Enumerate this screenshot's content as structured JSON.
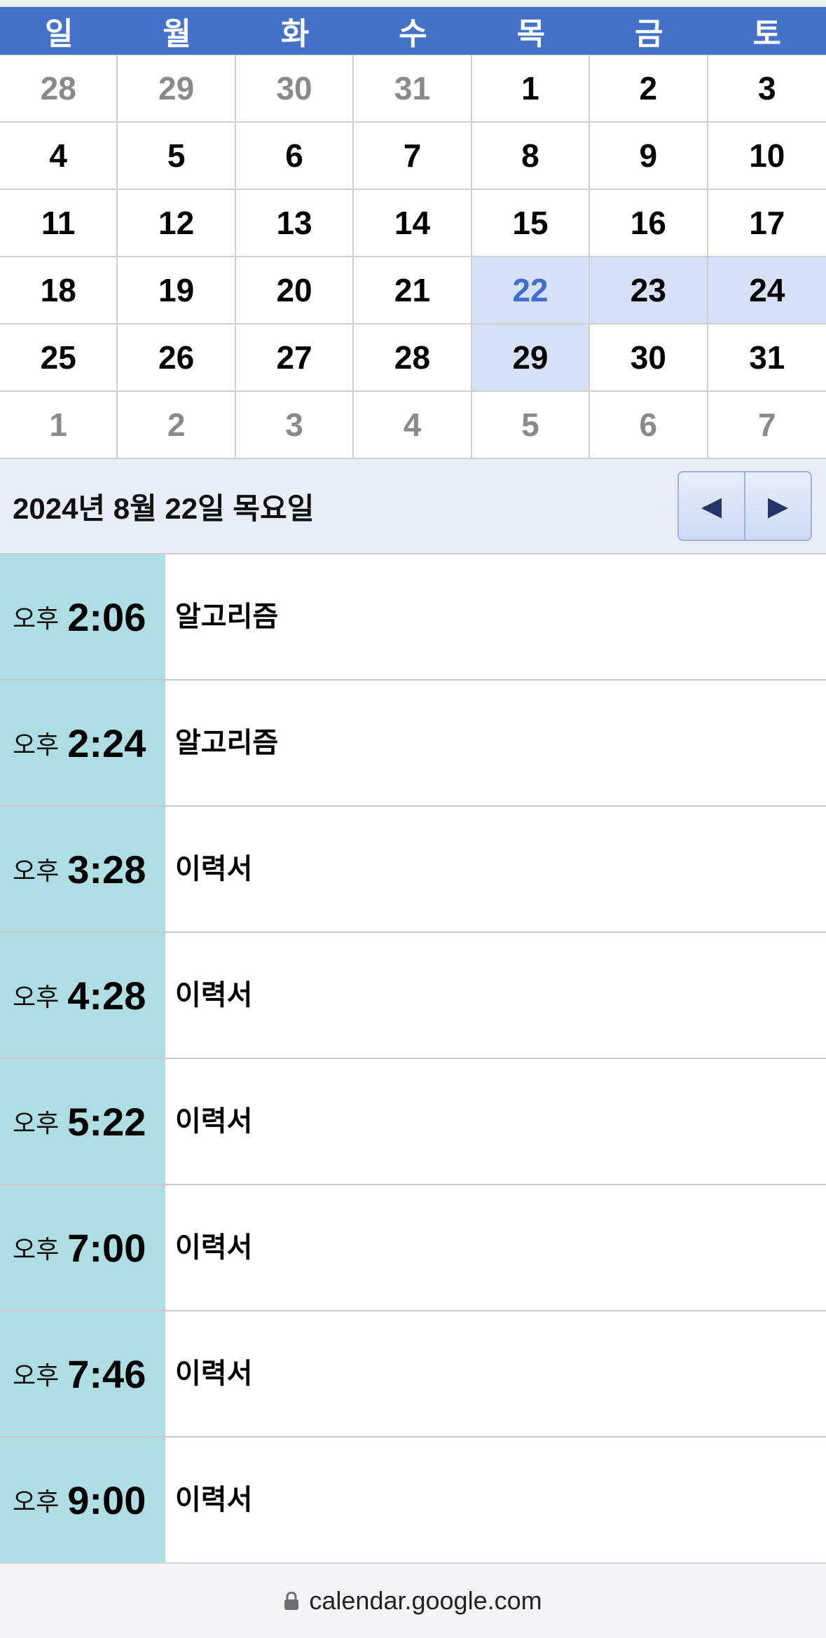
{
  "calendar": {
    "weekdays": [
      "일",
      "월",
      "화",
      "수",
      "목",
      "금",
      "토"
    ],
    "weeks": [
      [
        "28",
        "29",
        "30",
        "31",
        "1",
        "2",
        "3"
      ],
      [
        "4",
        "5",
        "6",
        "7",
        "8",
        "9",
        "10"
      ],
      [
        "11",
        "12",
        "13",
        "14",
        "15",
        "16",
        "17"
      ],
      [
        "18",
        "19",
        "20",
        "21",
        "22",
        "23",
        "24"
      ],
      [
        "25",
        "26",
        "27",
        "28",
        "29",
        "30",
        "31"
      ],
      [
        "1",
        "2",
        "3",
        "4",
        "5",
        "6",
        "7"
      ]
    ]
  },
  "date_header": {
    "title": "2024년 8월 22일 목요일",
    "prev_icon": "◀",
    "next_icon": "▶"
  },
  "events": [
    {
      "ampm": "오후",
      "time": "2:06",
      "title": "알고리즘"
    },
    {
      "ampm": "오후",
      "time": "2:24",
      "title": "알고리즘"
    },
    {
      "ampm": "오후",
      "time": "3:28",
      "title": "이력서"
    },
    {
      "ampm": "오후",
      "time": "4:28",
      "title": "이력서"
    },
    {
      "ampm": "오후",
      "time": "5:22",
      "title": "이력서"
    },
    {
      "ampm": "오후",
      "time": "7:00",
      "title": "이력서"
    },
    {
      "ampm": "오후",
      "time": "7:46",
      "title": "이력서"
    },
    {
      "ampm": "오후",
      "time": "9:00",
      "title": "이력서"
    }
  ],
  "browser": {
    "url": "calendar.google.com"
  },
  "colors": {
    "header_blue": "#4472c9",
    "selected_week": "#d6e1f8",
    "today_text": "#3f6ed0",
    "time_cell": "#aedde3"
  }
}
